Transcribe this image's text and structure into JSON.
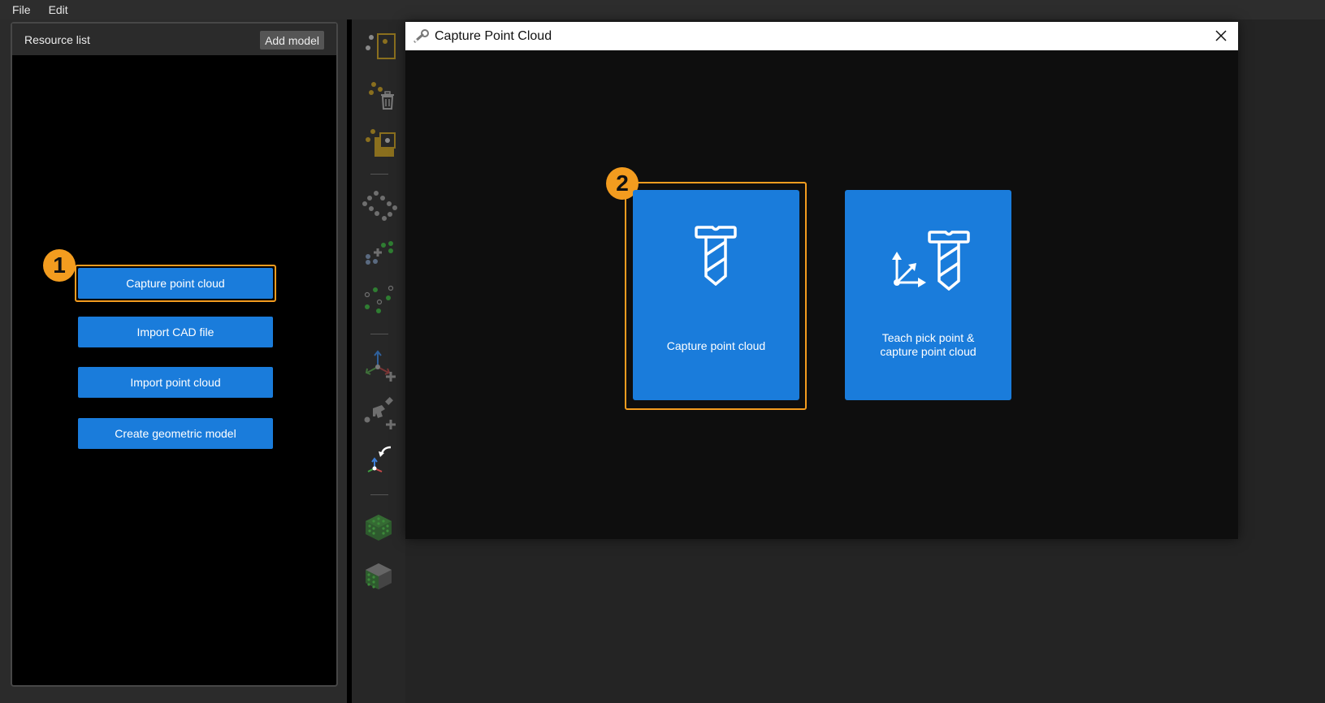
{
  "menubar": {
    "items": [
      {
        "label": "File"
      },
      {
        "label": "Edit"
      }
    ]
  },
  "resource_panel": {
    "title": "Resource list",
    "add_model_label": "Add model",
    "actions": [
      {
        "label": "Capture point cloud",
        "highlighted": true
      },
      {
        "label": "Import CAD file"
      },
      {
        "label": "Import point cloud"
      },
      {
        "label": "Create geometric model"
      }
    ]
  },
  "annotations": {
    "step1": "1",
    "step2": "2",
    "highlight_color": "#f39c1f"
  },
  "toolbar": {
    "tools": [
      {
        "icon": "select-points-in-box-icon"
      },
      {
        "icon": "delete-points-icon"
      },
      {
        "icon": "crop-points-icon"
      },
      {
        "icon": "point-cloud-outline-icon"
      },
      {
        "icon": "add-points-icon"
      },
      {
        "icon": "point-cloud-toggle-icon"
      },
      {
        "icon": "add-coordinate-frame-icon"
      },
      {
        "icon": "add-gripper-icon"
      },
      {
        "icon": "reset-frame-icon"
      },
      {
        "icon": "show-point-cube-icon"
      },
      {
        "icon": "show-solid-cube-icon"
      }
    ]
  },
  "dialog": {
    "title": "Capture Point Cloud",
    "title_icon": "wrench-icon",
    "options": [
      {
        "label": "Capture point cloud",
        "icon": "screw-icon",
        "highlighted": true
      },
      {
        "label_line1": "Teach pick point &",
        "label_line2": "capture point cloud",
        "icon": "axes-screw-icon"
      }
    ]
  },
  "colors": {
    "button_blue": "#1a7cdb",
    "accent_orange": "#f39c1f",
    "background": "#2b2b2b"
  }
}
